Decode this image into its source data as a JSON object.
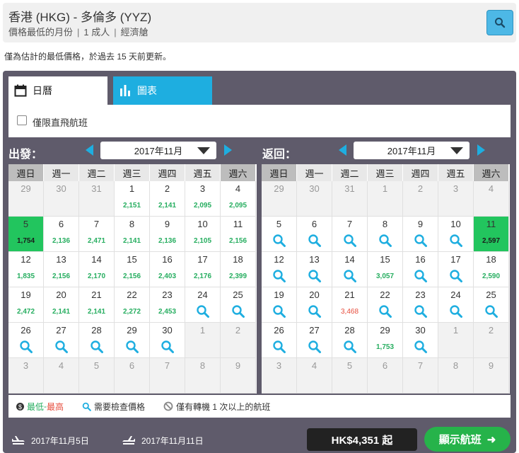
{
  "header": {
    "route": "香港 (HKG) - 多倫多 (YYZ)",
    "sub_fare": "價格最低的月份",
    "sub_pax": "1 成人",
    "sub_cabin": "經濟艙",
    "search_icon": "search-icon"
  },
  "notice": "僅為估計的最低價格，於過去 15 天前更新。",
  "tabs": {
    "calendar": "日曆",
    "chart": "圖表"
  },
  "filter": {
    "direct_only": "僅限直飛航班"
  },
  "outbound": {
    "label": "出發：",
    "month": "2017年11月"
  },
  "return": {
    "label": "返回：",
    "month": "2017年11月"
  },
  "weekdays": [
    "週日",
    "週一",
    "週二",
    "週三",
    "週四",
    "週五",
    "週六"
  ],
  "outbound_calendar": [
    [
      {
        "d": "29",
        "o": 1
      },
      {
        "d": "30",
        "o": 1
      },
      {
        "d": "31",
        "o": 1
      },
      {
        "d": "1",
        "p": "2,151"
      },
      {
        "d": "2",
        "p": "2,141"
      },
      {
        "d": "3",
        "p": "2,095"
      },
      {
        "d": "4",
        "p": "2,095"
      }
    ],
    [
      {
        "d": "5",
        "p": "1,754",
        "s": 1
      },
      {
        "d": "6",
        "p": "2,136"
      },
      {
        "d": "7",
        "p": "2,471"
      },
      {
        "d": "8",
        "p": "2,141"
      },
      {
        "d": "9",
        "p": "2,136"
      },
      {
        "d": "10",
        "p": "2,105"
      },
      {
        "d": "11",
        "p": "2,156"
      }
    ],
    [
      {
        "d": "12",
        "p": "1,835"
      },
      {
        "d": "13",
        "p": "2,156"
      },
      {
        "d": "14",
        "p": "2,170"
      },
      {
        "d": "15",
        "p": "2,156"
      },
      {
        "d": "16",
        "p": "2,403"
      },
      {
        "d": "17",
        "p": "2,176"
      },
      {
        "d": "18",
        "p": "2,399"
      }
    ],
    [
      {
        "d": "19",
        "p": "2,472"
      },
      {
        "d": "20",
        "p": "2,141"
      },
      {
        "d": "21",
        "p": "2,141"
      },
      {
        "d": "22",
        "p": "2,272"
      },
      {
        "d": "23",
        "p": "2,453"
      },
      {
        "d": "24",
        "q": 1
      },
      {
        "d": "25",
        "q": 1
      }
    ],
    [
      {
        "d": "26",
        "q": 1
      },
      {
        "d": "27",
        "q": 1
      },
      {
        "d": "28",
        "q": 1
      },
      {
        "d": "29",
        "q": 1
      },
      {
        "d": "30",
        "q": 1
      },
      {
        "d": "1",
        "o": 1
      },
      {
        "d": "2",
        "o": 1
      }
    ],
    [
      {
        "d": "3",
        "o": 1
      },
      {
        "d": "4",
        "o": 1
      },
      {
        "d": "5",
        "o": 1
      },
      {
        "d": "6",
        "o": 1
      },
      {
        "d": "7",
        "o": 1
      },
      {
        "d": "8",
        "o": 1
      },
      {
        "d": "9",
        "o": 1
      }
    ]
  ],
  "return_calendar": [
    [
      {
        "d": "29",
        "o": 1
      },
      {
        "d": "30",
        "o": 1
      },
      {
        "d": "31",
        "o": 1
      },
      {
        "d": "1",
        "o": 1
      },
      {
        "d": "2",
        "o": 1
      },
      {
        "d": "3",
        "o": 1
      },
      {
        "d": "4",
        "o": 1
      }
    ],
    [
      {
        "d": "5",
        "q": 1
      },
      {
        "d": "6",
        "q": 1
      },
      {
        "d": "7",
        "q": 1
      },
      {
        "d": "8",
        "q": 1
      },
      {
        "d": "9",
        "q": 1
      },
      {
        "d": "10",
        "q": 1
      },
      {
        "d": "11",
        "p": "2,597",
        "s": 1
      }
    ],
    [
      {
        "d": "12",
        "q": 1
      },
      {
        "d": "13",
        "q": 1
      },
      {
        "d": "14",
        "q": 1
      },
      {
        "d": "15",
        "p": "3,057"
      },
      {
        "d": "16",
        "q": 1
      },
      {
        "d": "17",
        "q": 1
      },
      {
        "d": "18",
        "p": "2,590"
      }
    ],
    [
      {
        "d": "19",
        "q": 1
      },
      {
        "d": "20",
        "q": 1
      },
      {
        "d": "21",
        "p": "3,468",
        "h": 1
      },
      {
        "d": "22",
        "q": 1
      },
      {
        "d": "23",
        "q": 1
      },
      {
        "d": "24",
        "q": 1
      },
      {
        "d": "25",
        "q": 1
      }
    ],
    [
      {
        "d": "26",
        "q": 1
      },
      {
        "d": "27",
        "q": 1
      },
      {
        "d": "28",
        "q": 1
      },
      {
        "d": "29",
        "p": "1,753"
      },
      {
        "d": "30",
        "q": 1
      },
      {
        "d": "1",
        "o": 1
      },
      {
        "d": "2",
        "o": 1
      }
    ],
    [
      {
        "d": "3",
        "o": 1
      },
      {
        "d": "4",
        "o": 1
      },
      {
        "d": "5",
        "o": 1
      },
      {
        "d": "6",
        "o": 1
      },
      {
        "d": "7",
        "o": 1
      },
      {
        "d": "8",
        "o": 1
      },
      {
        "d": "9",
        "o": 1
      }
    ]
  ],
  "legend": {
    "low": "最低",
    "dash": " - ",
    "high": "最高",
    "check": "需要檢查價格",
    "stops": "僅有轉機 1 次以上的航班"
  },
  "footer": {
    "depart_date": "2017年11月5日",
    "return_date": "2017年11月11日",
    "price": "HK$4,351 起",
    "show_flights": "顯示航班",
    "arrow": "➜"
  },
  "colors": {
    "selected": "#22c55e",
    "low_price": "#27ae60",
    "high_price": "#e74c3c",
    "accent": "#1eaee0",
    "panel": "#5f5b6b"
  }
}
